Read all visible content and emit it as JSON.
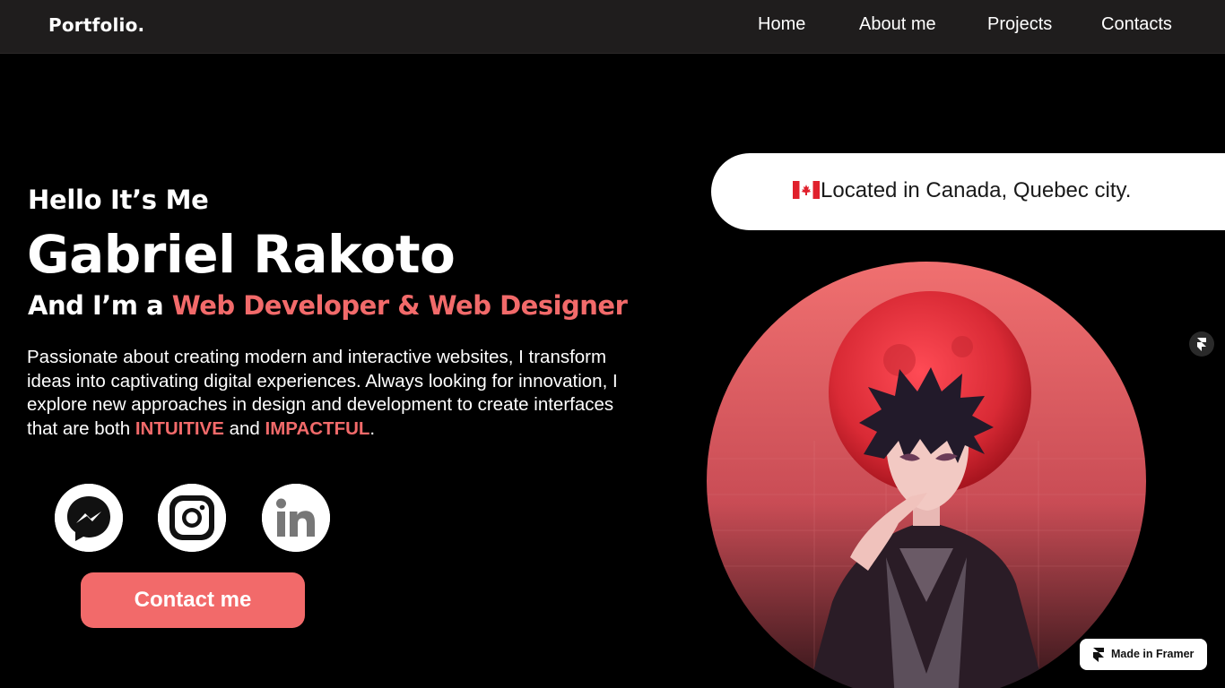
{
  "nav": {
    "logo": "Portfolio.",
    "links": [
      "Home",
      "About me",
      "Projects",
      "Contacts"
    ]
  },
  "hero": {
    "greeting": "Hello It’s Me",
    "name": "Gabriel Rakoto",
    "role_prefix": "And I’m a ",
    "role_accent": "Web Developer & Web Designer",
    "description_part1": "Passionate about creating modern and interactive websites, I transform ideas into captivating digital experiences. Always looking for innovation, I explore new approaches in design and development to create interfaces that are both ",
    "highlight1": "INTUITIVE",
    "description_and": " and ",
    "highlight2": "IMPACTFUL",
    "description_end": ".",
    "contact_button": "Contact me"
  },
  "social": {
    "icons": [
      "messenger-icon",
      "instagram-icon",
      "linkedin-icon"
    ]
  },
  "location": {
    "text": "Located in Canada, Quebec city."
  },
  "badge": {
    "made_in_framer": "Made in Framer"
  },
  "colors": {
    "accent": "#f26a6a",
    "nav_bg": "#1f1d1d",
    "page_bg": "#000000"
  }
}
